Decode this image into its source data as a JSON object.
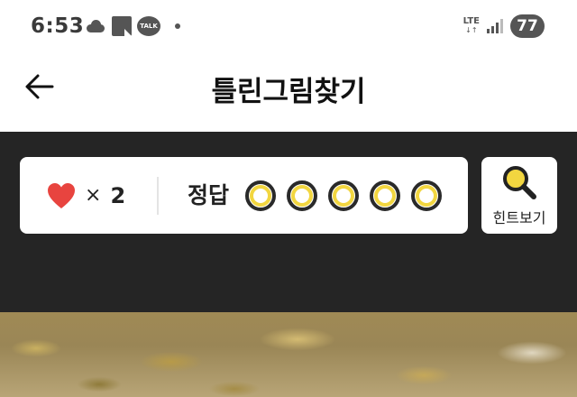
{
  "status_bar": {
    "time": "6:53",
    "talk_badge": "TALK",
    "network": "LTE",
    "battery": "77"
  },
  "header": {
    "title": "틀린그림찾기"
  },
  "game": {
    "lives_multiplier": "×",
    "lives": "2",
    "answer_label": "정답",
    "answers_total": 5,
    "answers_found": 0,
    "hint_label": "힌트보기"
  },
  "colors": {
    "panel_bg": "#252525",
    "heart": "#e8443f",
    "slot_ring": "#f2d640",
    "hint_lens": "#f2d640"
  },
  "icons": [
    "back-arrow-icon",
    "heart-icon",
    "magnifier-icon",
    "cloud-icon",
    "talk-icon",
    "signal-icon"
  ]
}
